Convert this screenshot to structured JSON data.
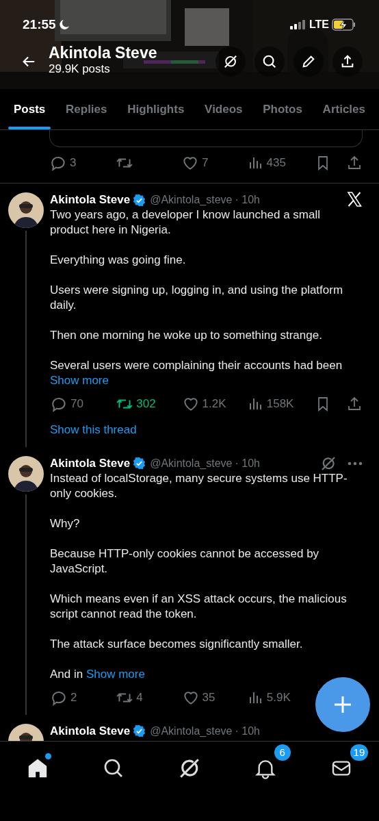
{
  "status_bar": {
    "time": "21:55",
    "network": "LTE"
  },
  "header": {
    "title": "Akintola Steve",
    "subtitle": "29.9K posts"
  },
  "tabs": [
    {
      "label": "Posts",
      "selected": true
    },
    {
      "label": "Replies",
      "selected": false
    },
    {
      "label": "Highlights",
      "selected": false
    },
    {
      "label": "Videos",
      "selected": false
    },
    {
      "label": "Photos",
      "selected": false
    },
    {
      "label": "Articles",
      "selected": false
    }
  ],
  "posts": [
    {
      "kind": "stats_only",
      "reposted": false,
      "stats": {
        "replies": "3",
        "likes": "7",
        "views": "435"
      }
    },
    {
      "kind": "full",
      "name": "Akintola Steve",
      "handle": "@Akintola_steve",
      "time": "· 10h",
      "x_logo": true,
      "body": [
        "Two years ago, a developer I know launched a small product here in Nigeria.",
        "Everything was going fine.",
        "Users were signing up, logging in, and using the platform daily.",
        "Then one morning he woke up to something strange.",
        "Several users were complaining their accounts had been"
      ],
      "show_more": "Show more",
      "reposted": true,
      "stats": {
        "replies": "70",
        "reposts": "302",
        "likes": "1.2K",
        "views": "158K"
      },
      "thread_link": "Show this thread"
    },
    {
      "kind": "full",
      "name": "Akintola Steve",
      "handle": "@Akintola_steve",
      "time": "· 10h",
      "grok_button": true,
      "more_menu": true,
      "body": [
        "Instead of localStorage, many secure systems use HTTP-only cookies.",
        "Why?",
        "Because HTTP-only cookies cannot be accessed by JavaScript.",
        "Which means even if an XSS attack occurs, the malicious script cannot read the token.",
        "The attack surface becomes significantly smaller.",
        "And in"
      ],
      "show_more": "Show more",
      "reposted": false,
      "stats": {
        "replies": "2",
        "reposts": "4",
        "likes": "35",
        "views": "5.9K"
      }
    },
    {
      "kind": "header_only",
      "name": "Akintola Steve",
      "handle": "@Akintola_steve",
      "time": "· 10h"
    }
  ],
  "nav": [
    {
      "kind": "home",
      "selected": true,
      "dot": true
    },
    {
      "kind": "search",
      "selected": false
    },
    {
      "kind": "grok",
      "selected": false
    },
    {
      "kind": "bell",
      "selected": false,
      "badge": "6"
    },
    {
      "kind": "mail",
      "selected": false,
      "badge": "19"
    }
  ]
}
